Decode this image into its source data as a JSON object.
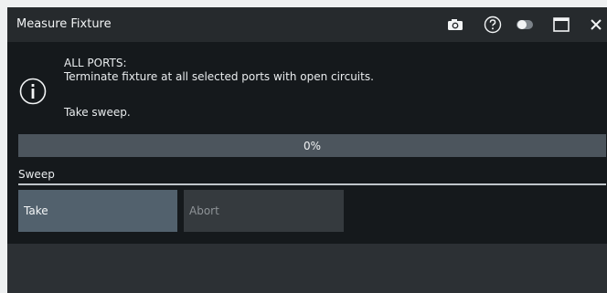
{
  "window": {
    "title": "Measure Fixture",
    "controls": {
      "camera": "camera-icon",
      "help": "help-icon",
      "toggle": "toggle-icon",
      "maximize": "maximize-icon",
      "close": "close-icon"
    }
  },
  "message": {
    "icon": "info-icon",
    "line1": "ALL PORTS:",
    "line2": "Terminate fixture at all selected ports with open circuits.",
    "line3": "Take sweep."
  },
  "progress": {
    "value": 0,
    "text": "0%"
  },
  "sweep": {
    "label": "Sweep",
    "take_label": "Take",
    "abort_label": "Abort",
    "abort_enabled": false
  },
  "colors": {
    "title_bar": "#262a2d",
    "content_bg": "#15191c",
    "take_button": "#52616d",
    "abort_button": "#353a3e",
    "progress_track": "#4c555d"
  }
}
